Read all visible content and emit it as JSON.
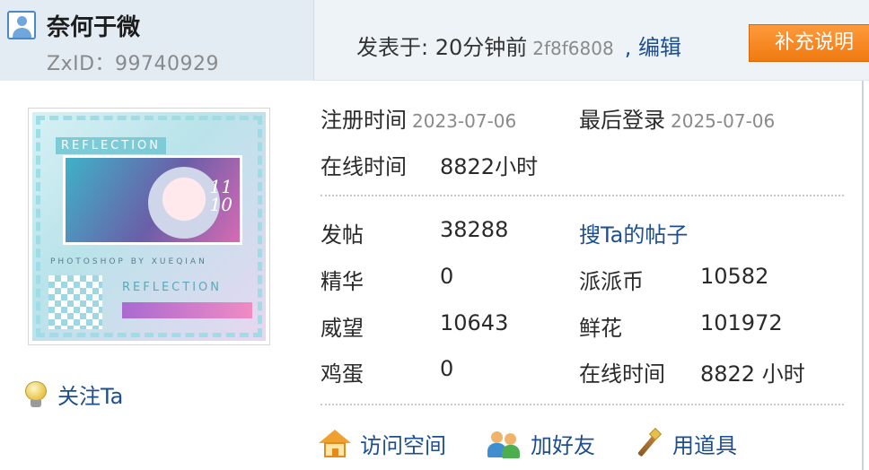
{
  "header": {
    "username": "奈何于微",
    "zxid_label": "ZxID：99740929",
    "posted_prefix": "发表于: 20分钟前",
    "post_hash": "2f8f6808",
    "edit_label": ", 编辑",
    "supplement_button": "补充说明"
  },
  "profile": {
    "avatar_text": {
      "title": "REFLECTION",
      "date": "11\n10",
      "credit": "PHOTOSHOP BY XUEQIAN",
      "title_bottom": "REFLECTION"
    },
    "follow_label": "关注Ta"
  },
  "info": {
    "register_label": "注册时间",
    "register_date": "2023-07-06",
    "last_login_label": "最后登录",
    "last_login_date": "2025-07-06",
    "online_label": "在线时间",
    "online_value": "8822小时"
  },
  "stats": {
    "posts_label": "发帖",
    "posts_value": "38288",
    "search_posts_link": "搜Ta的帖子",
    "essence_label": "精华",
    "essence_value": "0",
    "coins_label": "派派币",
    "coins_value": "10582",
    "prestige_label": "威望",
    "prestige_value": "10643",
    "flowers_label": "鲜花",
    "flowers_value": "101972",
    "eggs_label": "鸡蛋",
    "eggs_value": "0",
    "online_label": "在线时间",
    "online_value": "8822 小时"
  },
  "actions": {
    "visit_space": "访问空间",
    "add_friend": "加好友",
    "use_item": "用道具"
  },
  "colors": {
    "link": "#1d4e8f",
    "button_orange": "#f07a10",
    "header_bg": "#eef3f8"
  },
  "icons": [
    "user-icon",
    "bulb-icon",
    "home-icon",
    "friends-icon",
    "wand-icon"
  ]
}
